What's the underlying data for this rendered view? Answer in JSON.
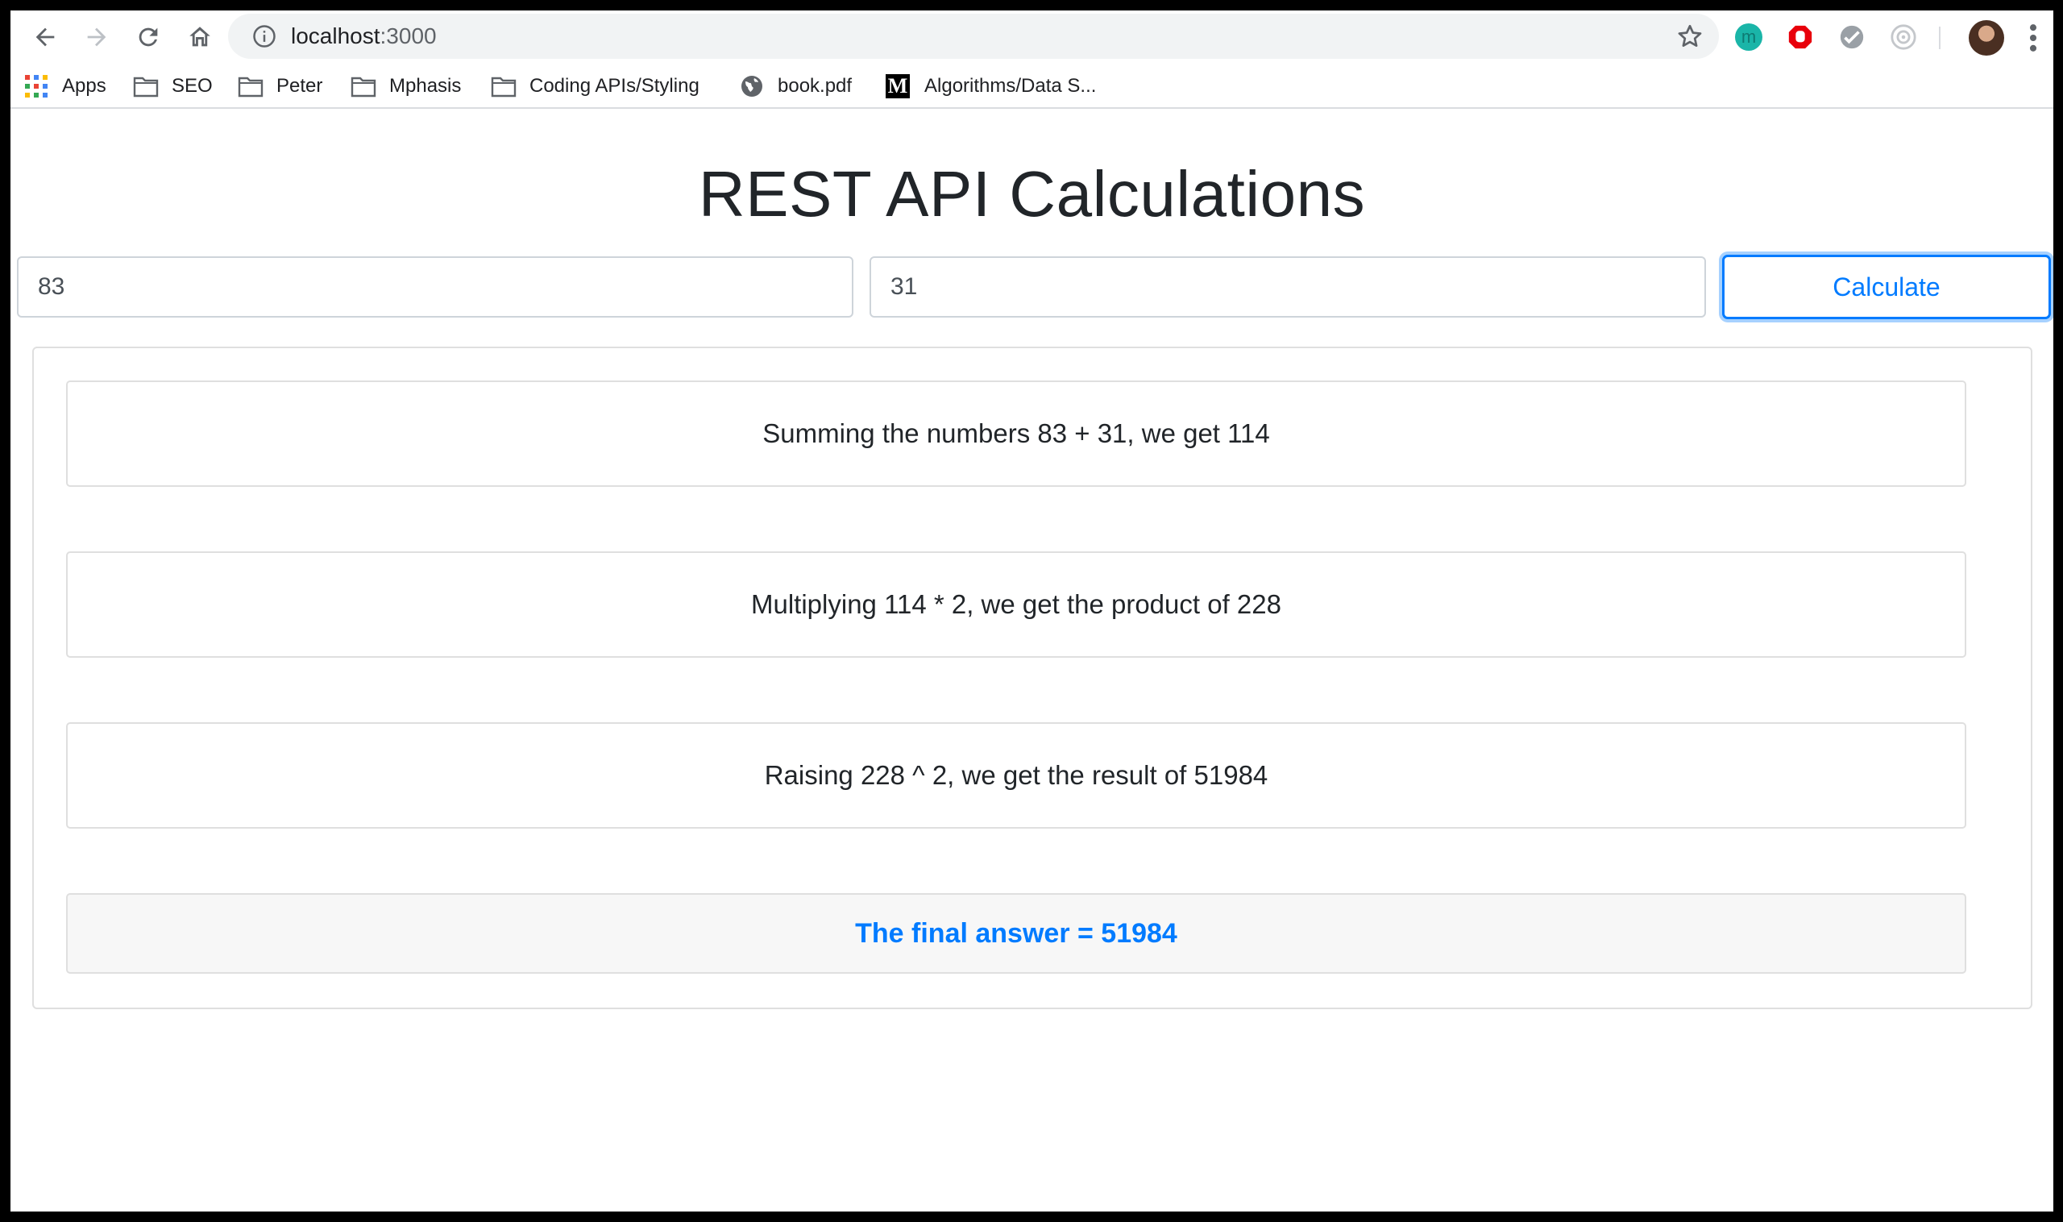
{
  "browser": {
    "url_host": "localhost",
    "url_port": ":3000",
    "extensions": [
      "m-extension-icon",
      "stop-extension-icon",
      "check-extension-icon",
      "target-extension-icon"
    ]
  },
  "bookmarks": [
    {
      "label": "Apps",
      "icon": "apps-grid-icon"
    },
    {
      "label": "SEO",
      "icon": "folder-icon"
    },
    {
      "label": "Peter",
      "icon": "folder-icon"
    },
    {
      "label": "Mphasis",
      "icon": "folder-icon"
    },
    {
      "label": "Coding APIs/Styling",
      "icon": "folder-icon"
    },
    {
      "label": "book.pdf",
      "icon": "globe-icon"
    },
    {
      "label": "Algorithms/Data S...",
      "icon": "medium-logo-icon"
    }
  ],
  "page": {
    "title": "REST API Calculations",
    "input_a": "83",
    "input_b": "31",
    "calculate_label": "Calculate",
    "steps": [
      "Summing the numbers 83 + 31, we get 114",
      "Multiplying 114 * 2, we get the product of 228",
      "Raising 228 ^ 2, we get the result of 51984"
    ],
    "final_answer": "The final answer = 51984"
  },
  "colors": {
    "accent": "#007bff",
    "text": "#212529",
    "border": "#dfdfdf",
    "final_bg": "#f7f7f7"
  }
}
